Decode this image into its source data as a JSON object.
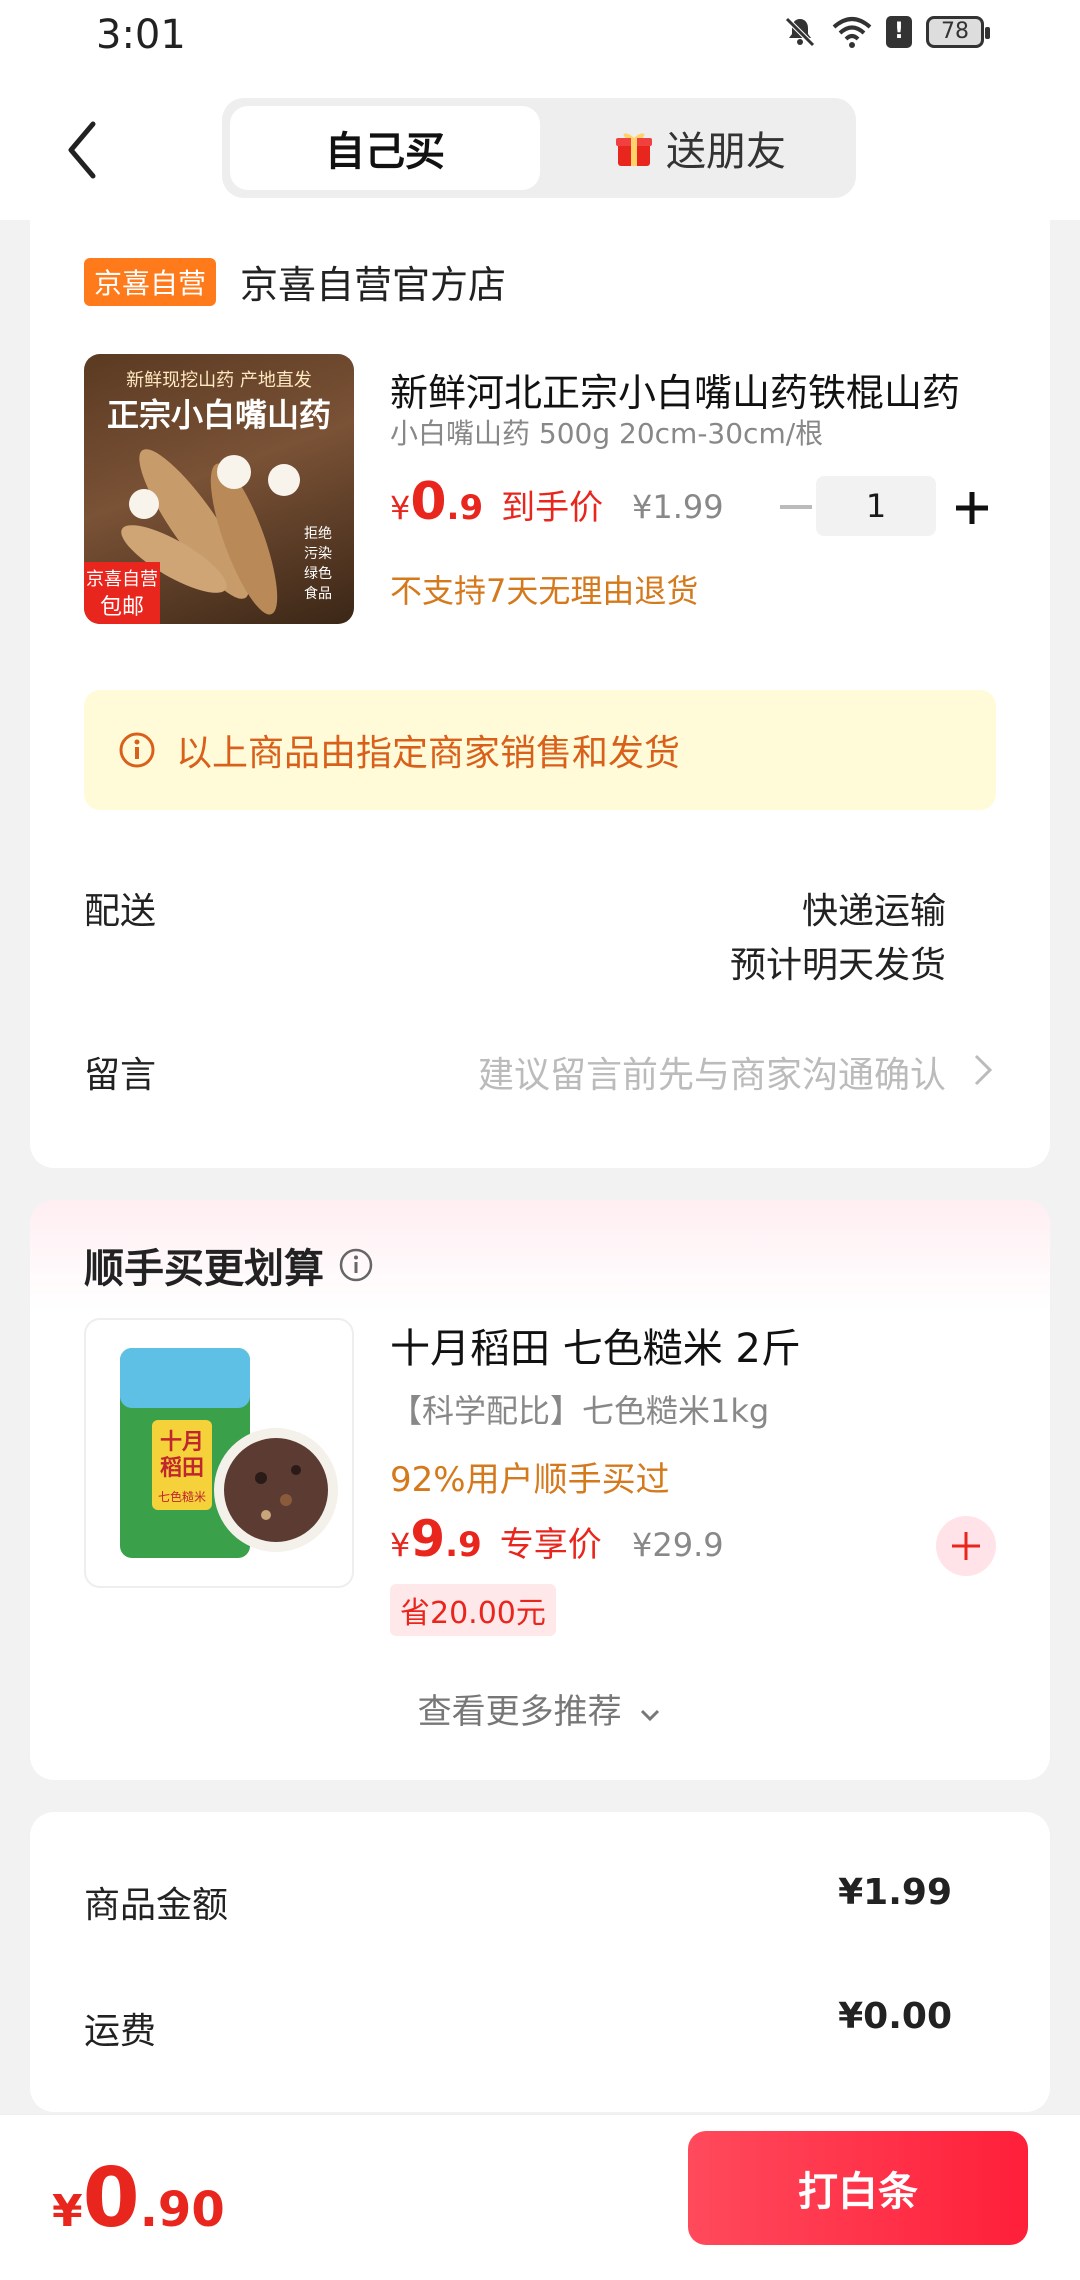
{
  "status_bar": {
    "time": "3:01",
    "battery": "78"
  },
  "nav": {
    "tab_self": "自己买",
    "tab_gift": "送朋友"
  },
  "shop": {
    "tag": "京喜自营",
    "name": "京喜自营官方店"
  },
  "product": {
    "image_banner": "新鲜现挖山药 产地直发",
    "image_title": "正宗小白嘴山药",
    "image_tag_line1": "京喜自营",
    "image_tag_line2": "包邮",
    "image_side": "拒绝污染 绿色食品",
    "title": "新鲜河北正宗小白嘴山药铁棍山药",
    "spec": "小白嘴山药 500g 20cm-30cm/根",
    "price_symbol": "¥",
    "price_int": "0",
    "price_dec": ".9",
    "price_label": "到手价",
    "original_price": "¥1.99",
    "quantity": "1",
    "no_return": "不支持7天无理由退货"
  },
  "notice": {
    "text": "以上商品由指定商家销售和发货"
  },
  "delivery": {
    "label": "配送",
    "method": "快递运输",
    "eta": "预计明天发货"
  },
  "message": {
    "label": "留言",
    "placeholder": "建议留言前先与商家沟通确认"
  },
  "recommend": {
    "title": "顺手买更划算",
    "item": {
      "title": "十月稻田 七色糙米 2斤",
      "desc": "【科学配比】七色糙米1kg",
      "bought": "92%用户顺手买过",
      "price_symbol": "¥",
      "price_int": "9",
      "price_dec": ".9",
      "price_label": "专享价",
      "original_price": "¥29.9",
      "save": "省20.00元",
      "image_brand": "十月稻田",
      "image_sub": "七色糙米"
    },
    "more": "查看更多推荐"
  },
  "summary": {
    "goods_label": "商品金额",
    "goods_value": "¥1.99",
    "freight_label": "运费",
    "freight_value": "¥0.00"
  },
  "bottom": {
    "total_symbol": "¥",
    "total_int": "0",
    "total_dec": ".90",
    "pay_label": "打白条"
  },
  "colors": {
    "accent_red": "#e8261d",
    "orange": "#ff7a1a",
    "warning_text": "#d4791c"
  }
}
